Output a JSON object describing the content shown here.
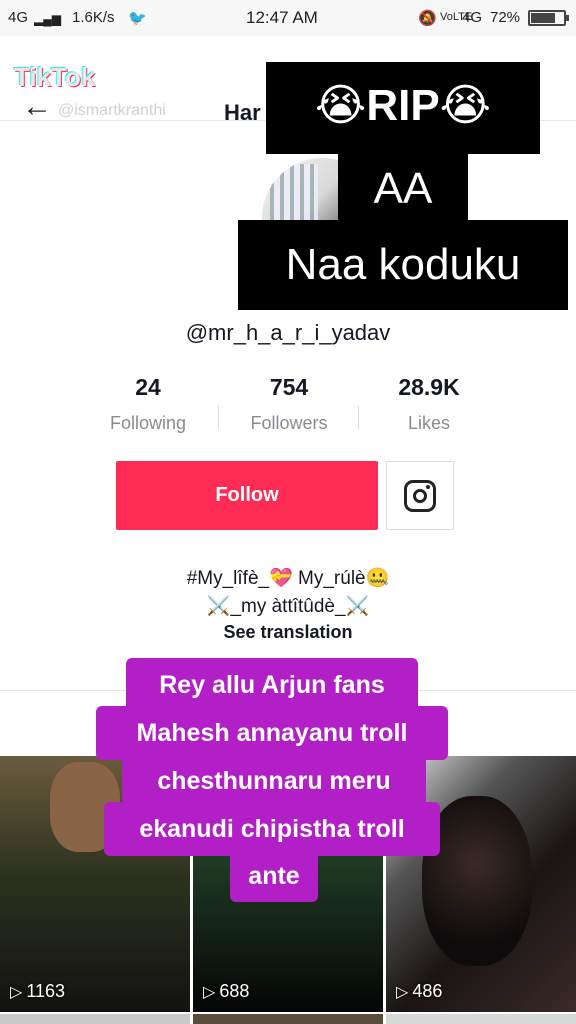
{
  "status_bar": {
    "network_left": "4G",
    "speed": "1.6K/s",
    "time": "12:47 AM",
    "network_right": "4G",
    "battery": "72%",
    "battery_level": 0.72
  },
  "header": {
    "watermark_logo": "TikTok",
    "watermark_user": "@ismartkranthi",
    "title": "Har"
  },
  "profile": {
    "handle": "@mr_h_a_r_i_yadav",
    "stats": [
      {
        "value": "24",
        "label": "Following"
      },
      {
        "value": "754",
        "label": "Followers"
      },
      {
        "value": "28.9K",
        "label": "Likes"
      }
    ],
    "follow_label": "Follow",
    "bio_line1": "#My_lîfè_💝  My_rúlè🤐",
    "bio_line2": "⚔️_my àttîtûdè_⚔️",
    "see_translation": "See translation"
  },
  "overlay_top": {
    "line1": "😭RIP😭",
    "line2": "AA",
    "line3": "Naa koduku"
  },
  "overlay_bottom": {
    "lines": [
      "Rey allu Arjun fans",
      "Mahesh annayanu troll",
      "chesthunnaru meru",
      "ekanudi chipistha troll",
      "ante"
    ]
  },
  "videos": [
    {
      "views": "1163"
    },
    {
      "views": "688"
    },
    {
      "views": "486"
    }
  ],
  "colors": {
    "follow": "#fe2c55",
    "overlay_pink": "#b31fc7",
    "overlay_black": "#000000"
  }
}
